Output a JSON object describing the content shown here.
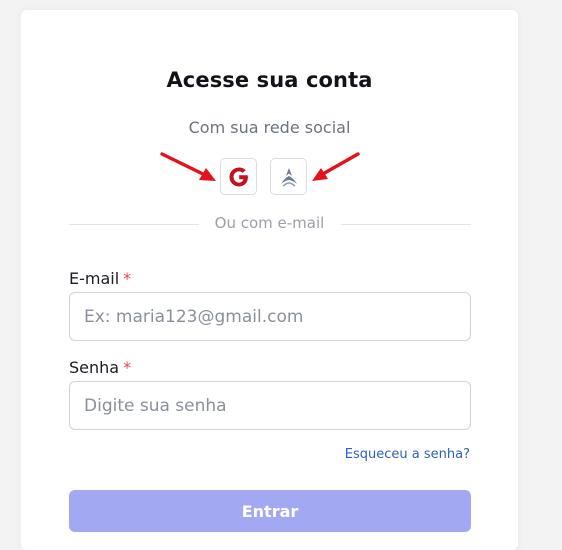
{
  "card": {
    "title": "Acesse sua conta",
    "subtitle": "Com sua rede social",
    "social": {
      "google_icon": "google-icon",
      "church_icon": "adventist-flame-icon"
    },
    "divider_text": "Ou com e-mail"
  },
  "form": {
    "email": {
      "label": "E-mail",
      "required_mark": "*",
      "placeholder": "Ex: maria123@gmail.com",
      "value": ""
    },
    "password": {
      "label": "Senha",
      "required_mark": "*",
      "placeholder": "Digite sua senha",
      "value": ""
    },
    "forgot_link": "Esqueceu a senha?",
    "submit_label": "Entrar"
  },
  "colors": {
    "annotation_arrow": "#e3121b",
    "google_red": "#c1121f",
    "submit_bg": "#a3a8f2",
    "link": "#2e5fbf",
    "required": "#e5484d"
  }
}
